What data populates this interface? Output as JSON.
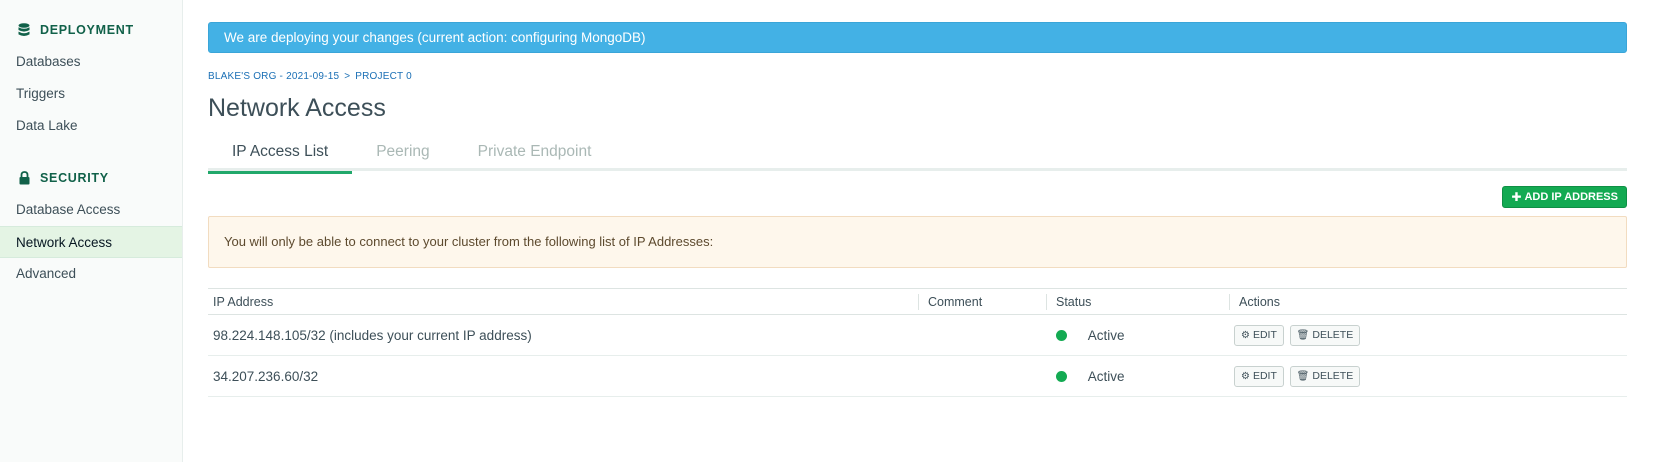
{
  "sidebar": {
    "deployment": {
      "title": "DEPLOYMENT",
      "icon": "database-icon",
      "items": [
        {
          "label": "Databases"
        },
        {
          "label": "Triggers"
        },
        {
          "label": "Data Lake"
        }
      ]
    },
    "security": {
      "title": "SECURITY",
      "icon": "lock-icon",
      "items": [
        {
          "label": "Database Access"
        },
        {
          "label": "Network Access",
          "active": true
        },
        {
          "label": "Advanced"
        }
      ]
    }
  },
  "banner": {
    "text": "We are deploying your changes (current action: configuring MongoDB)",
    "color": "#43b1e5"
  },
  "breadcrumb": {
    "org": "BLAKE'S ORG - 2021-09-15",
    "separator": ">",
    "project": "PROJECT 0"
  },
  "page_title": "Network Access",
  "tabs": [
    {
      "label": "IP Access List",
      "active": true
    },
    {
      "label": "Peering"
    },
    {
      "label": "Private Endpoint"
    }
  ],
  "add_button": {
    "label": "ADD IP ADDRESS",
    "icon": "plus-icon",
    "color": "#13aa52"
  },
  "notice": {
    "text": "You will only be able to connect to your cluster from the following list of IP Addresses:"
  },
  "table": {
    "columns": {
      "ip": "IP Address",
      "comment": "Comment",
      "status": "Status",
      "actions": "Actions"
    },
    "rows": [
      {
        "ip": "98.224.148.105/32  (includes your current IP address)",
        "comment": "",
        "status": "Active",
        "edit": "EDIT",
        "delete": "DELETE"
      },
      {
        "ip": "34.207.236.60/32",
        "comment": "",
        "status": "Active",
        "edit": "EDIT",
        "delete": "DELETE"
      }
    ]
  },
  "colors": {
    "accent_green": "#13aa52",
    "status_active": "#13aa52",
    "link_blue": "#1a6fb5"
  }
}
